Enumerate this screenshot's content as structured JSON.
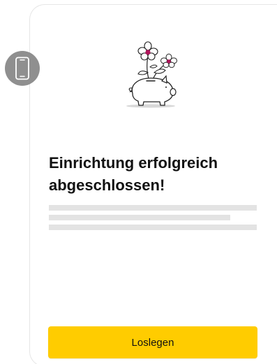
{
  "device_icon": "smartphone-icon",
  "illustration": "piggy-bank-flowers-illustration",
  "heading": {
    "line1": "Einrichtung erfolgreich",
    "line2": "abgeschlossen!"
  },
  "primary_button": {
    "label": "Loslegen"
  },
  "colors": {
    "button": "#ffcc00",
    "badge": "#8f8f8f",
    "placeholder": "#e3e3e3",
    "flower_center": "#b0145a"
  }
}
